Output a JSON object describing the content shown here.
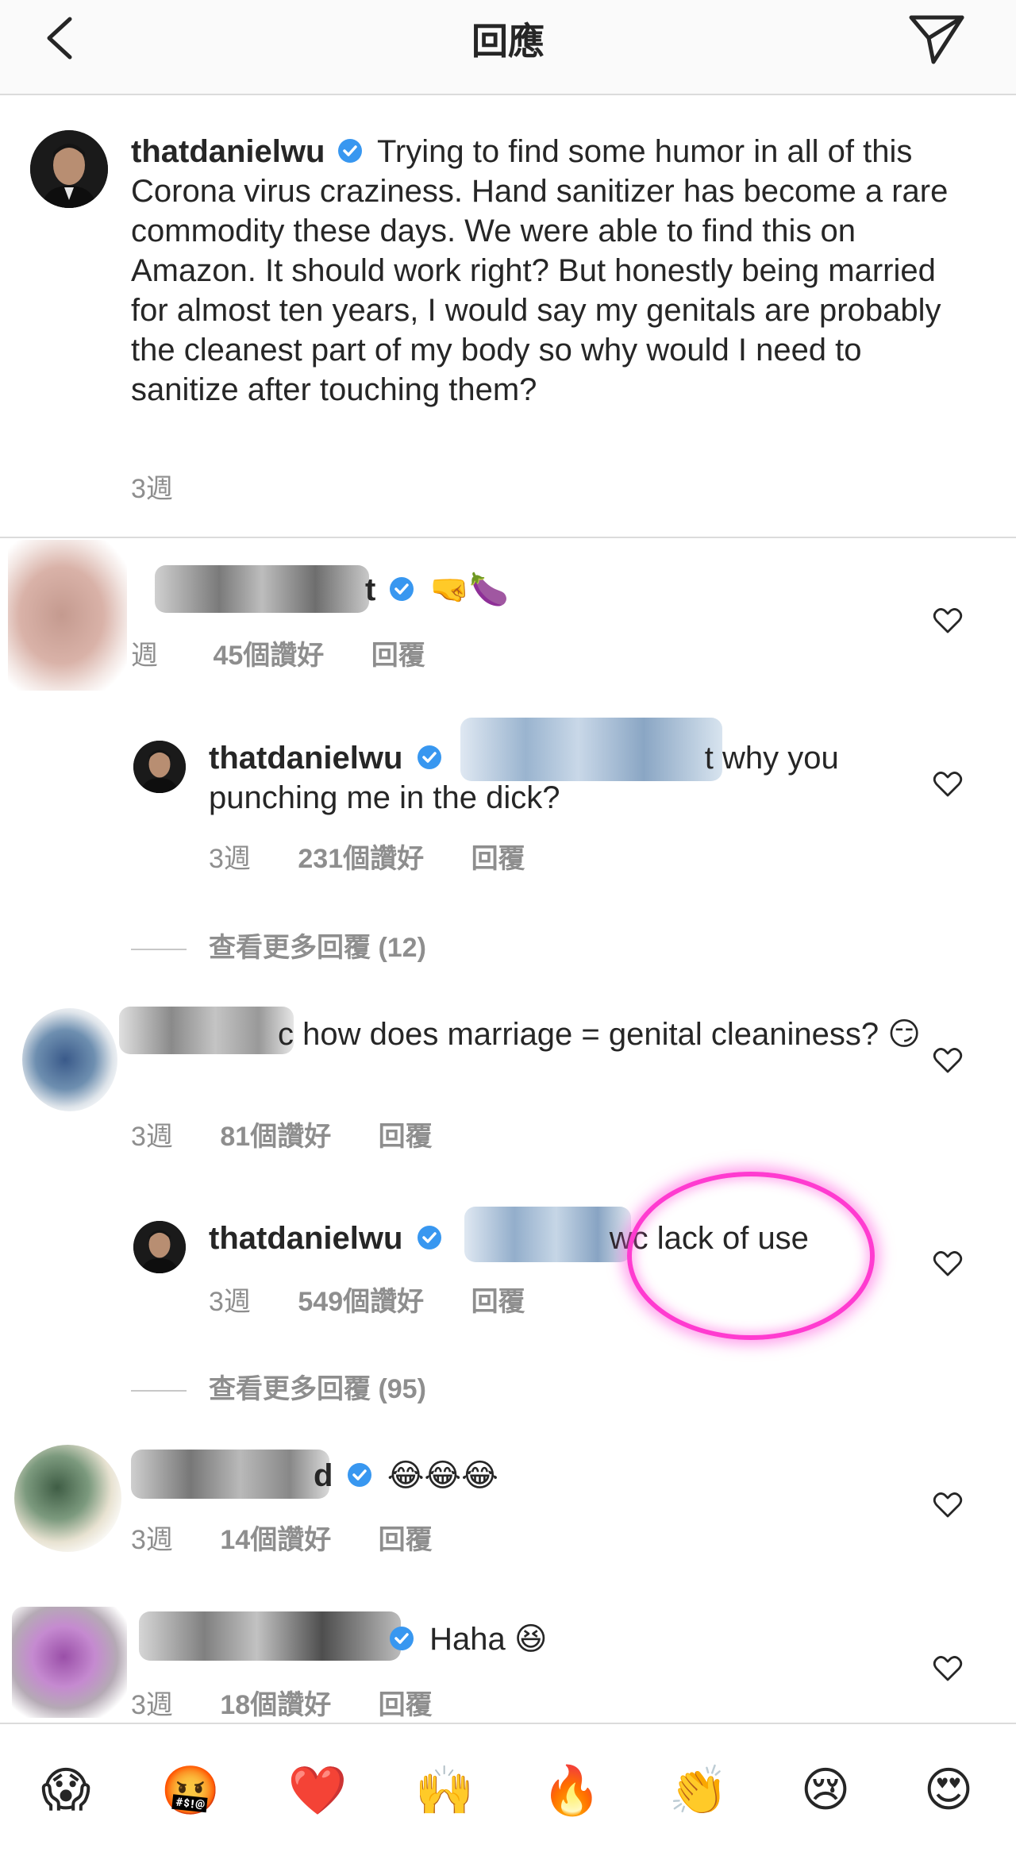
{
  "header": {
    "title": "回應",
    "back_icon": "chevron-left-icon",
    "send_icon": "paper-plane-icon"
  },
  "caption": {
    "username": "thatdanielwu",
    "text": "Trying to find some humor in all of this Corona virus craziness. Hand sanitizer has become a rare commodity these days. We were able to find this on Amazon. It should work right? But honestly being married for almost ten years, I would say my genitals are probably the cleanest part of my body so why would I need to sanitize after touching them?",
    "time": "3週"
  },
  "comments": [
    {
      "username_tail": "t",
      "text": "🤜🍆",
      "time": "週",
      "likes": "45個讚好",
      "reply": "回覆",
      "replies": [
        {
          "username": "thatdanielwu",
          "mention_tail": "t",
          "text": "why you punching me in the dick?",
          "time": "3週",
          "likes": "231個讚好",
          "reply": "回覆"
        }
      ],
      "more_replies": "查看更多回覆 (12)"
    },
    {
      "username_tail": "c",
      "text": "how does marriage = genital cleaniness? 😏",
      "time": "3週",
      "likes": "81個讚好",
      "reply": "回覆",
      "replies": [
        {
          "username": "thatdanielwu",
          "mention_tail": "wc",
          "text": "lack of use",
          "time": "3週",
          "likes": "549個讚好",
          "reply": "回覆"
        }
      ],
      "more_replies": "查看更多回覆 (95)"
    },
    {
      "username_tail": "d",
      "text": "😂😂😂",
      "time": "3週",
      "likes": "14個讚好",
      "reply": "回覆"
    },
    {
      "username_tail": "",
      "text": "Haha 😆",
      "time": "3週",
      "likes": "18個讚好",
      "reply": "回覆"
    }
  ],
  "emoji_bar": [
    "😱",
    "🤬",
    "❤️",
    "🙌",
    "🔥",
    "👏",
    "😢",
    "😍"
  ],
  "colors": {
    "verified": "#3897f0",
    "meta": "#8e8e8e",
    "highlight": "#ff3bd0"
  }
}
